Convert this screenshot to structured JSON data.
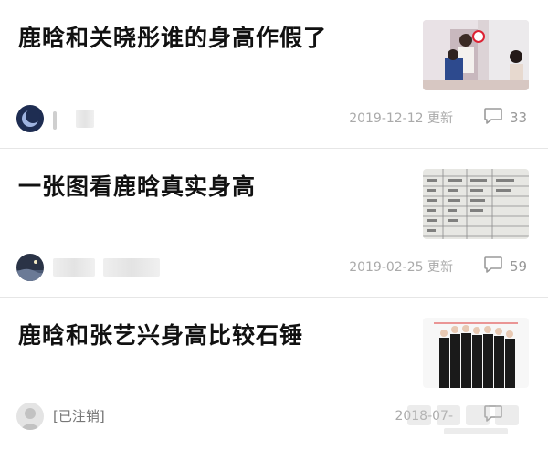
{
  "posts": [
    {
      "title": "鹿晗和关晓彤谁的身高作假了",
      "author": "",
      "date": "2019-12-12 更新",
      "comments": "33"
    },
    {
      "title": "一张图看鹿晗真实身高",
      "author": "",
      "date": "2019-02-25 更新",
      "comments": "59"
    },
    {
      "title": "鹿晗和张艺兴身高比较石锤",
      "author": "[已注销]",
      "date": "2018-07-",
      "comments": ""
    }
  ],
  "icons": {
    "comment": "comment-bubble-icon"
  },
  "colors": {
    "title": "#111111",
    "meta": "#aaaaaa",
    "divider": "#e6e6e6"
  }
}
